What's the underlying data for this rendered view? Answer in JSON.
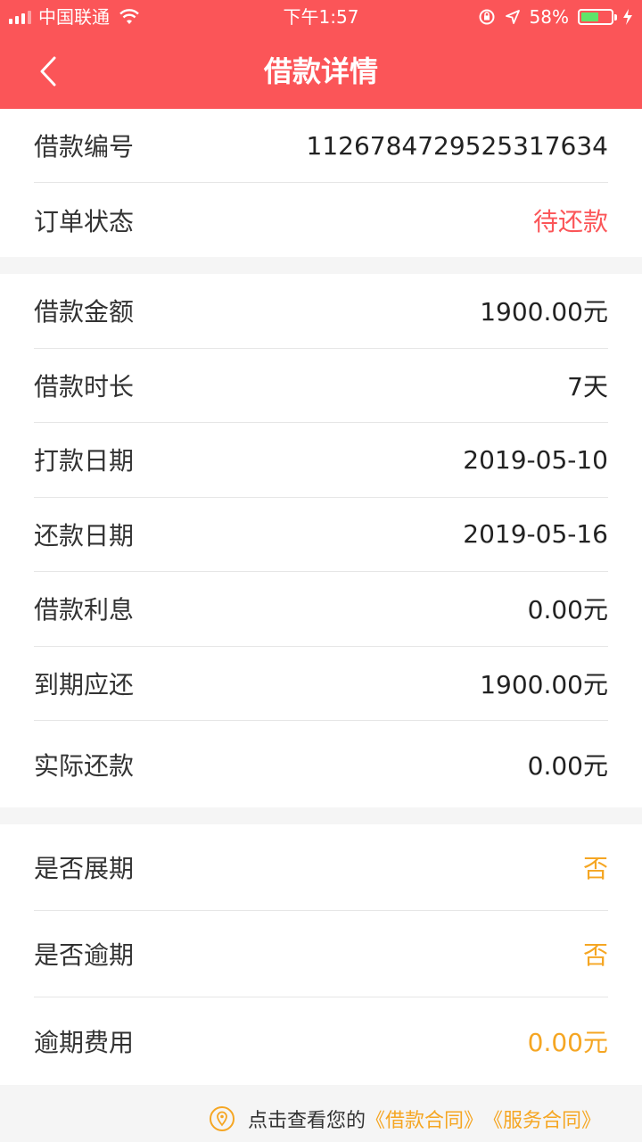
{
  "status": {
    "carrier": "中国联通",
    "time": "下午1:57",
    "battery": "58%",
    "battery_level": 0.58
  },
  "nav": {
    "title": "借款详情"
  },
  "group1": [
    {
      "label": "借款编号",
      "value": "1126784729525317634",
      "tone": "normal"
    },
    {
      "label": "订单状态",
      "value": "待还款",
      "tone": "red"
    }
  ],
  "group2": [
    {
      "label": "借款金额",
      "value": "1900.00元"
    },
    {
      "label": "借款时长",
      "value": "7天"
    },
    {
      "label": "打款日期",
      "value": "2019-05-10"
    },
    {
      "label": "还款日期",
      "value": "2019-05-16"
    },
    {
      "label": "借款利息",
      "value": "0.00元"
    },
    {
      "label": "到期应还",
      "value": "1900.00元"
    },
    {
      "label": "实际还款",
      "value": "0.00元"
    }
  ],
  "group3": [
    {
      "label": "是否展期",
      "value": "否"
    },
    {
      "label": "是否逾期",
      "value": "否"
    },
    {
      "label": "逾期费用",
      "value": "0.00元"
    }
  ],
  "footer": {
    "prefix": "点击查看您的",
    "link1": "《借款合同》",
    "link2": "《服务合同》"
  },
  "colors": {
    "brand": "#fb5558",
    "accent_orange": "#f5a623"
  }
}
